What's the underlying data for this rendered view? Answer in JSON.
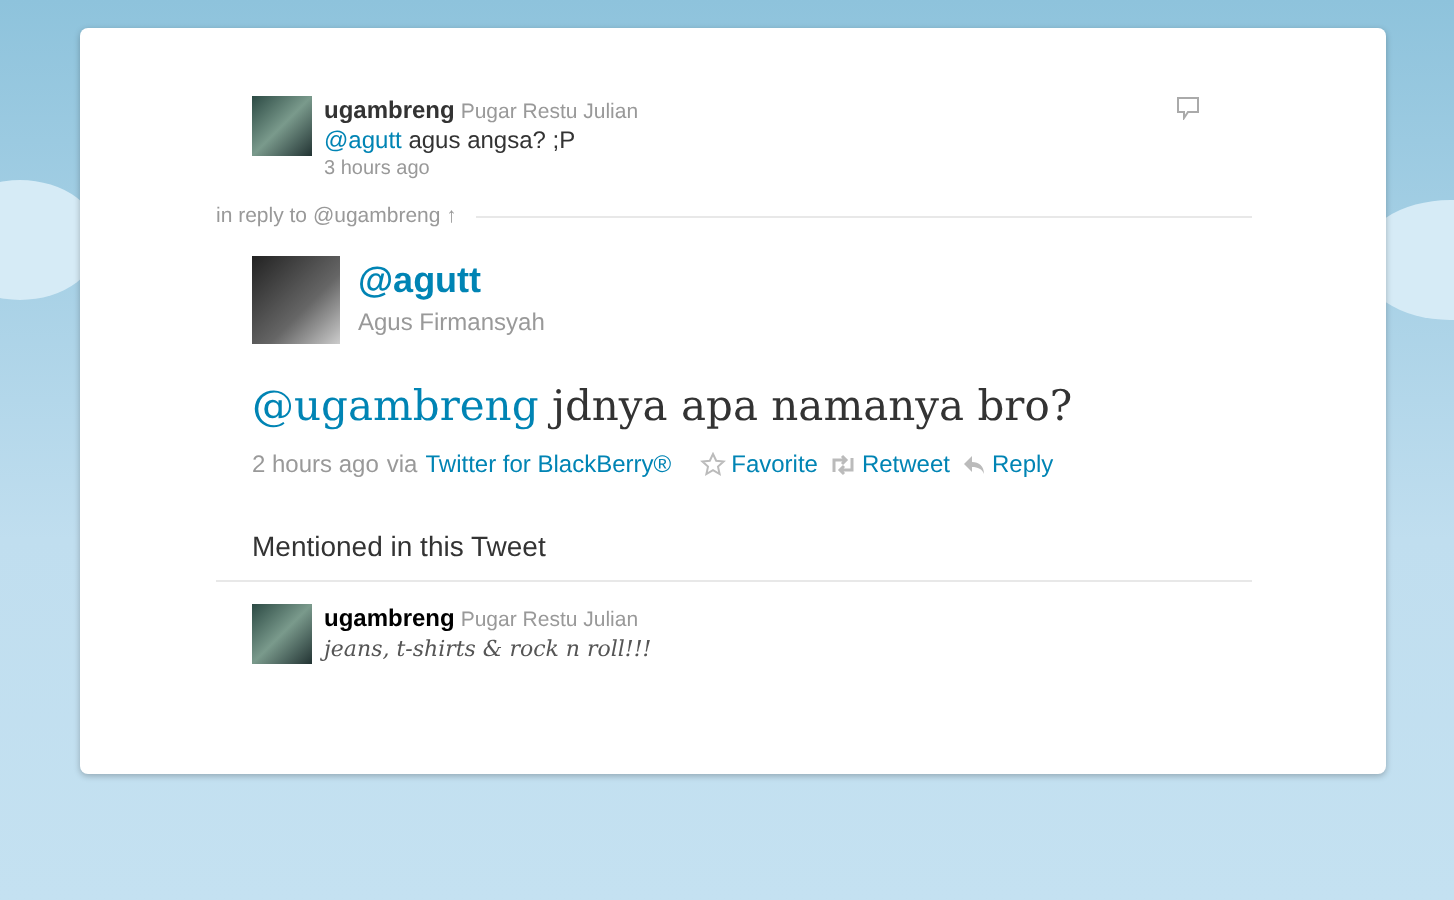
{
  "parent_tweet": {
    "username": "ugambreng",
    "full_name": "Pugar Restu Julian",
    "mention": "@agutt",
    "text": "agus angsa? ;P",
    "time": "3 hours ago"
  },
  "in_reply_to": "in reply to @ugambreng ↑",
  "tweet": {
    "username": "@agutt",
    "full_name": "Agus Firmansyah",
    "mention": "@ugambreng",
    "text": "jdnya apa namanya bro?",
    "time": "2 hours ago",
    "via": "via",
    "source": "Twitter for BlackBerry®",
    "actions": [
      {
        "kind": "favorite",
        "label": "Favorite"
      },
      {
        "kind": "retweet",
        "label": "Retweet"
      },
      {
        "kind": "reply",
        "label": "Reply"
      }
    ]
  },
  "mentioned": {
    "heading": "Mentioned in this Tweet",
    "users": [
      {
        "username": "ugambreng",
        "full_name": "Pugar Restu Julian",
        "bio": "jeans, t-shirts & rock n roll!!!"
      }
    ]
  }
}
